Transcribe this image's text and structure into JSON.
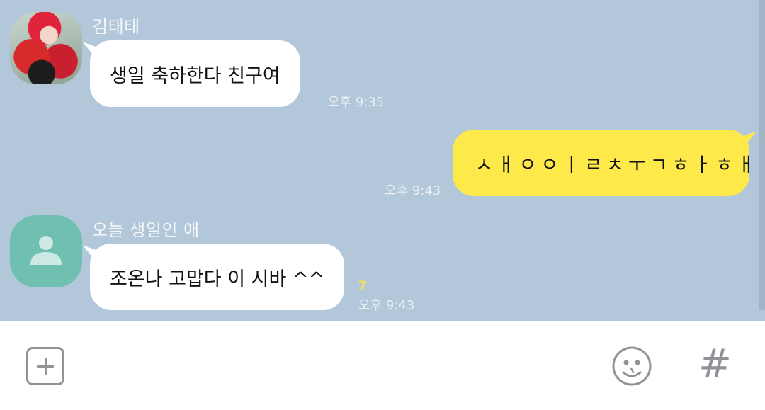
{
  "messages": [
    {
      "sender": "김태태",
      "text": "생일 축하한다 친구여",
      "time": "오후 9:35",
      "direction": "incoming"
    },
    {
      "text": "ㅅㅐㅇㅇㅣㄹㅊㅜㄱㅎㅏㅎㅐ",
      "time": "오후 9:43",
      "direction": "outgoing"
    },
    {
      "sender": "오늘 생일인 애",
      "text": "조온나 고맙다 이 시바 ^^",
      "time": "오후 9:43",
      "unread": "7",
      "direction": "incoming"
    }
  ],
  "input_bar": {
    "plus_icon": "plus-icon",
    "emoji_icon": "smiley-icon",
    "hash_label": "#"
  },
  "colors": {
    "chat_background": "#b2c7da",
    "outgoing_bubble": "#fee94a",
    "incoming_bubble": "#ffffff",
    "unread_count": "#f2e24b",
    "default_avatar": "#6fc0b1"
  }
}
